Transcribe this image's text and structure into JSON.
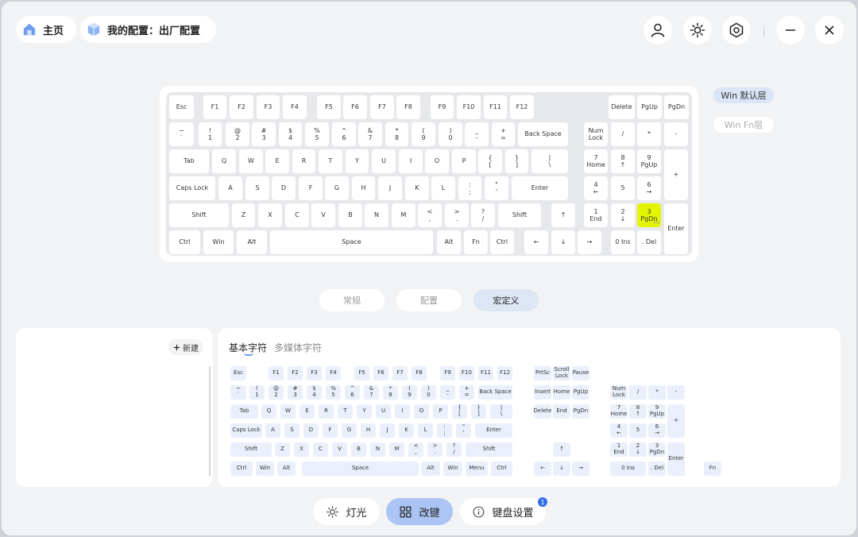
{
  "nav": {
    "home": "主页",
    "config": "我的配置：出厂配置"
  },
  "layers": {
    "default": "Win 默认层",
    "fn": "Win Fn层"
  },
  "mode_tabs": [
    "常规",
    "配置",
    "宏定义"
  ],
  "left_panel": {
    "new_button": "新建"
  },
  "char_tabs": {
    "basic": "基本字符",
    "media": "多媒体字符"
  },
  "bottom": {
    "light": "灯光",
    "remap": "改键",
    "settings": "键盘设置",
    "badge": "1"
  },
  "colors": {
    "accent": "#abc4f4",
    "highlight": "#e3f600",
    "key_bg": "#e9f0fb"
  },
  "keyboard": {
    "keys": [
      [
        "Esc"
      ],
      [
        "F1"
      ],
      [
        "F2"
      ],
      [
        "F3"
      ],
      [
        "F4"
      ],
      [
        "F5"
      ],
      [
        "F6"
      ],
      [
        "F7"
      ],
      [
        "F8"
      ],
      [
        "F9"
      ],
      [
        "F10"
      ],
      [
        "F11"
      ],
      [
        "F12"
      ],
      [
        "Delete"
      ],
      [
        "PgUp"
      ],
      [
        "PgDn"
      ],
      [
        "~",
        "`"
      ],
      [
        "!",
        "1"
      ],
      [
        "@",
        "2"
      ],
      [
        "#",
        "3"
      ],
      [
        "$",
        "4"
      ],
      [
        "%",
        "5"
      ],
      [
        "^",
        "6"
      ],
      [
        "&",
        "7"
      ],
      [
        "*",
        "8"
      ],
      [
        "(",
        "9"
      ],
      [
        ")",
        "0"
      ],
      [
        "_",
        "-"
      ],
      [
        "+",
        "="
      ],
      [
        "Back Space"
      ],
      [
        "Num",
        "Lock"
      ],
      [
        "/"
      ],
      [
        "*"
      ],
      [
        "-"
      ],
      [
        "Tab"
      ],
      [
        "Q"
      ],
      [
        "W"
      ],
      [
        "E"
      ],
      [
        "R"
      ],
      [
        "T"
      ],
      [
        "Y"
      ],
      [
        "U"
      ],
      [
        "I"
      ],
      [
        "O"
      ],
      [
        "P"
      ],
      [
        "{",
        "["
      ],
      [
        "}",
        "]"
      ],
      [
        "|",
        "\\"
      ],
      [
        "7",
        "Home"
      ],
      [
        "8",
        "↑"
      ],
      [
        "9",
        "PgUp"
      ],
      [
        "+"
      ],
      [
        "Caps Lock"
      ],
      [
        "A"
      ],
      [
        "S"
      ],
      [
        "D"
      ],
      [
        "F"
      ],
      [
        "G"
      ],
      [
        "H"
      ],
      [
        "J"
      ],
      [
        "K"
      ],
      [
        "L"
      ],
      [
        ":",
        ";"
      ],
      [
        "\"",
        "'"
      ],
      [
        "Enter"
      ],
      [
        "4",
        "←"
      ],
      [
        "5"
      ],
      [
        "6",
        "→"
      ],
      [
        "Shift"
      ],
      [
        "Z"
      ],
      [
        "X"
      ],
      [
        "C"
      ],
      [
        "V"
      ],
      [
        "B"
      ],
      [
        "N"
      ],
      [
        "M"
      ],
      [
        "<",
        ","
      ],
      [
        ">",
        "."
      ],
      [
        "?",
        "/"
      ],
      [
        "Shift"
      ],
      [
        "↑"
      ],
      [
        "1",
        "End"
      ],
      [
        "2",
        "↓"
      ],
      [
        "3",
        "PgDn"
      ],
      [
        "Enter"
      ],
      [
        "Ctrl"
      ],
      [
        "Win"
      ],
      [
        "Alt"
      ],
      [
        "Space"
      ],
      [
        "Alt"
      ],
      [
        "Fn"
      ],
      [
        "Ctrl"
      ],
      [
        "←"
      ],
      [
        "↓"
      ],
      [
        "→"
      ],
      [
        "0 Ins"
      ],
      [
        ". Del"
      ]
    ],
    "fn_sub": "Fn"
  },
  "macro_keyboard": {
    "keys": [
      [
        "Esc"
      ],
      [
        "F1"
      ],
      [
        "F2"
      ],
      [
        "F3"
      ],
      [
        "F4"
      ],
      [
        "F5"
      ],
      [
        "F6"
      ],
      [
        "F7"
      ],
      [
        "F8"
      ],
      [
        "F9"
      ],
      [
        "F10"
      ],
      [
        "F11"
      ],
      [
        "F12"
      ],
      [
        "PrtSc"
      ],
      [
        "Scroll",
        "Lock"
      ],
      [
        "Pause"
      ],
      [
        "~",
        "`"
      ],
      [
        "!",
        "1"
      ],
      [
        "@",
        "2"
      ],
      [
        "#",
        "3"
      ],
      [
        "$",
        "4"
      ],
      [
        "%",
        "5"
      ],
      [
        "^",
        "6"
      ],
      [
        "&",
        "7"
      ],
      [
        "*",
        "8"
      ],
      [
        "(",
        "9"
      ],
      [
        ")",
        "0"
      ],
      [
        "_",
        "-"
      ],
      [
        "+",
        "="
      ],
      [
        "Back Space"
      ],
      [
        "Insert"
      ],
      [
        "Home"
      ],
      [
        "PgUp"
      ],
      [
        "Num",
        "Lock"
      ],
      [
        "/"
      ],
      [
        "*"
      ],
      [
        "-"
      ],
      [
        "Tab"
      ],
      [
        "Q"
      ],
      [
        "W"
      ],
      [
        "E"
      ],
      [
        "R"
      ],
      [
        "T"
      ],
      [
        "Y"
      ],
      [
        "U"
      ],
      [
        "I"
      ],
      [
        "O"
      ],
      [
        "P"
      ],
      [
        "{",
        "["
      ],
      [
        "}",
        "]"
      ],
      [
        "|",
        "\\"
      ],
      [
        "Delete"
      ],
      [
        "End"
      ],
      [
        "PgDn"
      ],
      [
        "7",
        "Home"
      ],
      [
        "8",
        "↑"
      ],
      [
        "9",
        "PgUp"
      ],
      [
        "+"
      ],
      [
        "Caps Lock"
      ],
      [
        "A"
      ],
      [
        "S"
      ],
      [
        "D"
      ],
      [
        "F"
      ],
      [
        "G"
      ],
      [
        "H"
      ],
      [
        "J"
      ],
      [
        "K"
      ],
      [
        "L"
      ],
      [
        ":",
        ";"
      ],
      [
        "\"",
        "'"
      ],
      [
        "Enter"
      ],
      [
        "4",
        "←"
      ],
      [
        "5"
      ],
      [
        "6",
        "→"
      ],
      [
        "Shift"
      ],
      [
        "Z"
      ],
      [
        "X"
      ],
      [
        "C"
      ],
      [
        "V"
      ],
      [
        "B"
      ],
      [
        "N"
      ],
      [
        "M"
      ],
      [
        "<",
        ","
      ],
      [
        ">",
        "."
      ],
      [
        "?",
        "/"
      ],
      [
        "Shift"
      ],
      [
        "↑"
      ],
      [
        "1",
        "End"
      ],
      [
        "2",
        "↓"
      ],
      [
        "3",
        "PgDn"
      ],
      [
        "Enter"
      ],
      [
        "Ctrl"
      ],
      [
        "Win"
      ],
      [
        "Alt"
      ],
      [
        "Space"
      ],
      [
        "Alt"
      ],
      [
        "Win"
      ],
      [
        "Menu"
      ],
      [
        "Ctrl"
      ],
      [
        "←"
      ],
      [
        "↓"
      ],
      [
        "→"
      ],
      [
        "0 Ins"
      ],
      [
        ". Del"
      ],
      [
        "Fn"
      ]
    ]
  }
}
